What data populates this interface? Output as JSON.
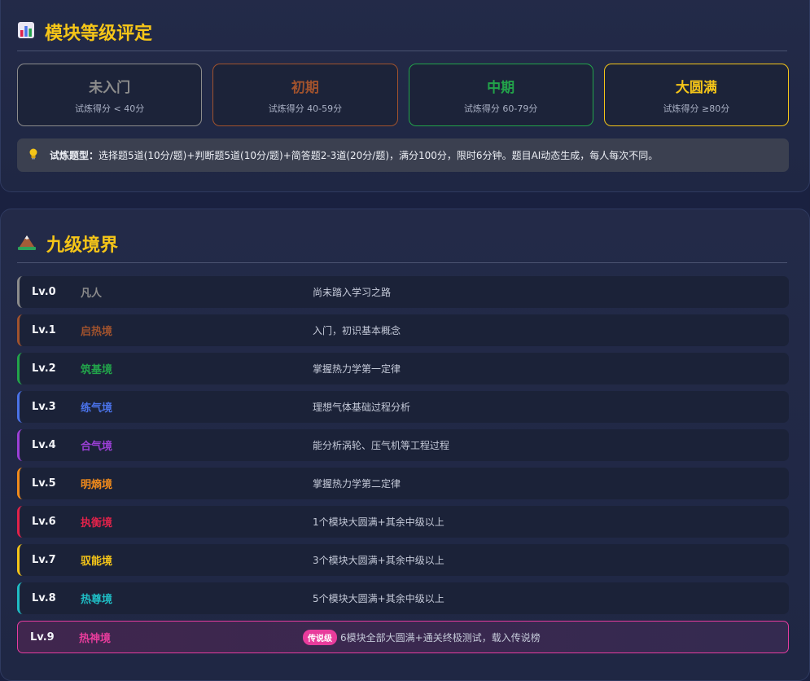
{
  "grades_panel": {
    "title": "模块等级评定",
    "icon": "bar-chart-icon",
    "cards": [
      {
        "name": "未入门",
        "sub": "试炼得分 < 40分",
        "color": "#8c8c8c"
      },
      {
        "name": "初期",
        "sub": "试炼得分 40-59分",
        "color": "#a0522d"
      },
      {
        "name": "中期",
        "sub": "试炼得分 60-79分",
        "color": "#22a34a"
      },
      {
        "name": "大圆满",
        "sub": "试炼得分 ≥80分",
        "color": "#f5c518"
      }
    ],
    "tip_icon": "lightbulb-icon",
    "tip_label": "试炼题型：",
    "tip_text": "选择题5道(10分/题)+判断题5道(10分/题)+简答题2-3道(20分/题)，满分100分，限时6分钟。题目AI动态生成，每人每次不同。"
  },
  "realms_panel": {
    "title": "九级境界",
    "icon": "mountain-icon",
    "realms": [
      {
        "lv": "Lv.0",
        "name": "凡人",
        "desc": "尚未踏入学习之路",
        "color": "#8c8c8c"
      },
      {
        "lv": "Lv.1",
        "name": "启热境",
        "desc": "入门，初识基本概念",
        "color": "#a0522d"
      },
      {
        "lv": "Lv.2",
        "name": "筑基境",
        "desc": "掌握热力学第一定律",
        "color": "#22a34a"
      },
      {
        "lv": "Lv.3",
        "name": "练气境",
        "desc": "理想气体基础过程分析",
        "color": "#4a72e8"
      },
      {
        "lv": "Lv.4",
        "name": "合气境",
        "desc": "能分析涡轮、压气机等工程过程",
        "color": "#9b3fd6"
      },
      {
        "lv": "Lv.5",
        "name": "明熵境",
        "desc": "掌握热力学第二定律",
        "color": "#f08a1c"
      },
      {
        "lv": "Lv.6",
        "name": "执衡境",
        "desc": "1个模块大圆满+其余中级以上",
        "color": "#e0224a"
      },
      {
        "lv": "Lv.7",
        "name": "驭能境",
        "desc": "3个模块大圆满+其余中级以上",
        "color": "#f5c518"
      },
      {
        "lv": "Lv.8",
        "name": "热尊境",
        "desc": "5个模块大圆满+其余中级以上",
        "color": "#1fbcc4"
      }
    ],
    "legend": {
      "lv": "Lv.9",
      "name": "热神境",
      "badge": "传说级",
      "desc": "6模块全部大圆满+通关终极测试，载入传说榜",
      "color": "#e83c9c"
    }
  }
}
